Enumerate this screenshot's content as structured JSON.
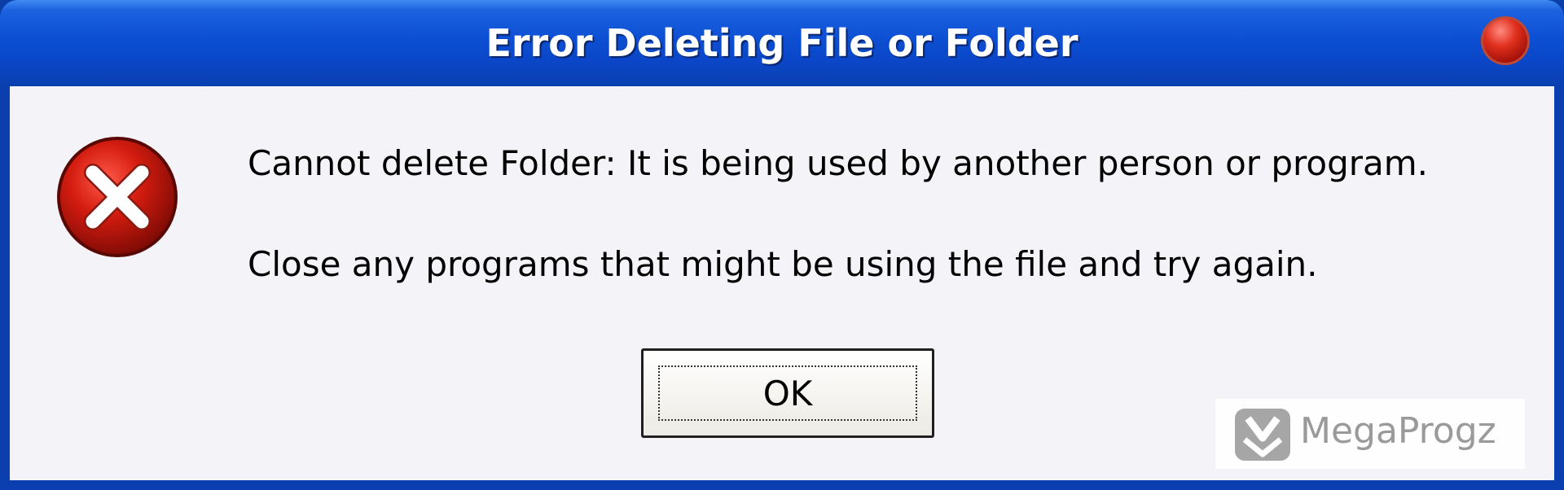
{
  "window": {
    "title": "Error Deleting File or Folder"
  },
  "icons": {
    "close": "close-icon",
    "error": "error-icon",
    "watermark": "megaprogz-logo-icon"
  },
  "colors": {
    "titlebar": "#0d4fd3",
    "client_background": "#f4f3f8",
    "error_red": "#c4130b",
    "close_button": "#e0301e"
  },
  "dialog": {
    "message_line1": "Cannot delete Folder: It is being used by another person or program.",
    "message_line2": "Close any programs that might be using the file and try again.",
    "ok_label": "OK"
  },
  "watermark": {
    "text": "MegaProgz"
  }
}
